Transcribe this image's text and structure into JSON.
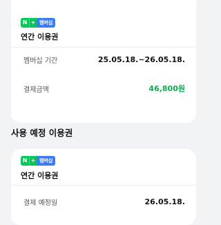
{
  "current_pass": {
    "badge": {
      "n": "N",
      "plus": "+",
      "label": "멤버십"
    },
    "title": "연간 이용권",
    "rows": [
      {
        "key": "멤버십 기간",
        "value": "25.05.18.~26.05.18."
      },
      {
        "key": "결제금액",
        "value": "46,800원"
      }
    ]
  },
  "scheduled_section": {
    "title": "사용 예정 이용권"
  },
  "scheduled_pass": {
    "badge": {
      "n": "N",
      "plus": "+",
      "label": "멤버십"
    },
    "title": "연간 이용권",
    "rows": [
      {
        "key": "결제 예정일",
        "value": "26.05.18."
      }
    ]
  },
  "colors": {
    "price_green": "#10a950",
    "badge_green": "#06c65a",
    "badge_blue": "#3a7bf6"
  }
}
